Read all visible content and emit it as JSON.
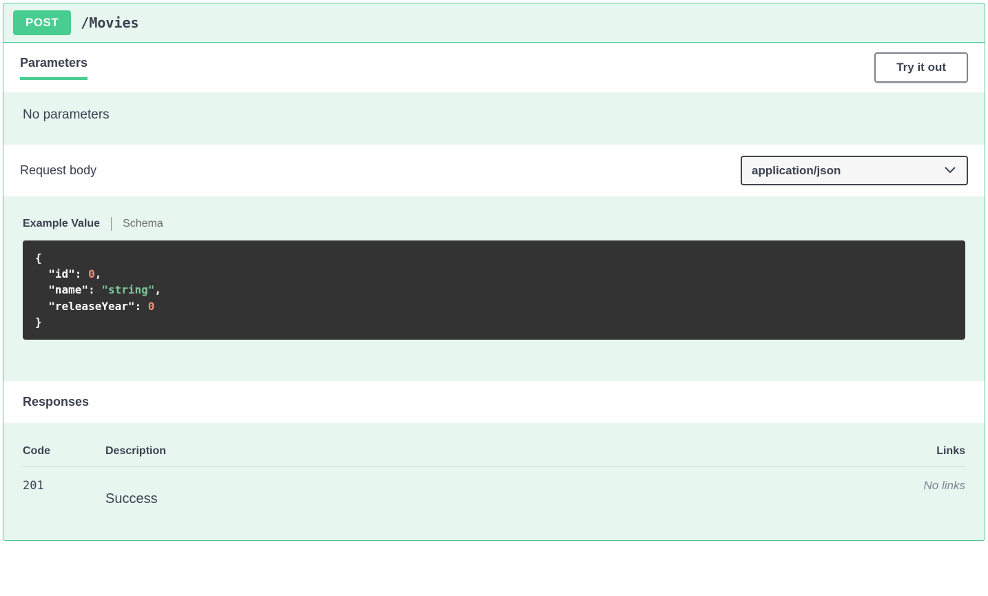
{
  "operation": {
    "method": "POST",
    "path": "/Movies"
  },
  "parameters": {
    "tab_label": "Parameters",
    "try_button": "Try it out",
    "empty_message": "No parameters"
  },
  "request_body": {
    "label": "Request body",
    "content_type": "application/json",
    "example_value_label": "Example Value",
    "schema_label": "Schema",
    "example": "{\n  \"id\": 0,\n  \"name\": \"string\",\n  \"releaseYear\": 0\n}"
  },
  "responses": {
    "label": "Responses",
    "columns": {
      "code": "Code",
      "description": "Description",
      "links": "Links"
    },
    "items": [
      {
        "code": "201",
        "description": "Success",
        "links": "No links"
      }
    ]
  }
}
